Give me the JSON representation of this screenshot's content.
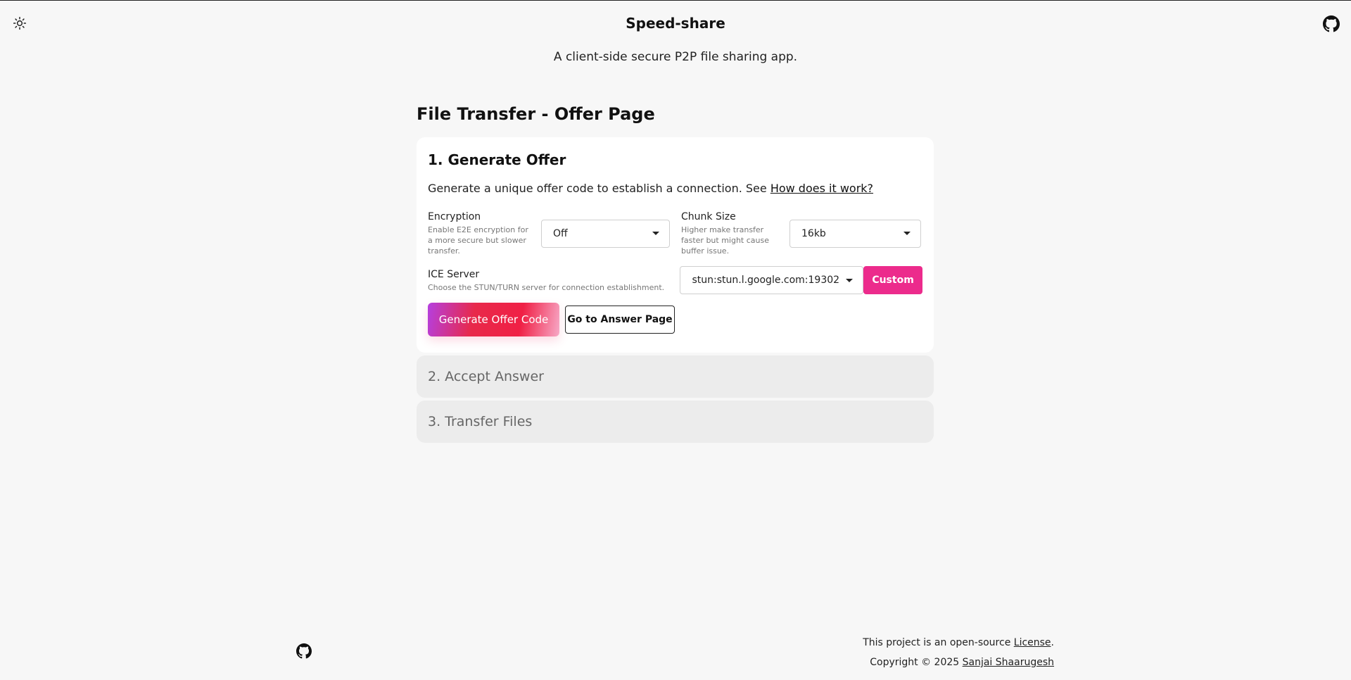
{
  "header": {
    "title": "Speed-share",
    "subtitle": "A client-side secure P2P file sharing app.",
    "theme_icon": "sun-icon",
    "github_icon": "github-icon"
  },
  "page": {
    "title": "File Transfer - Offer Page"
  },
  "step1": {
    "title": "1. Generate Offer",
    "desc_text": "Generate a unique offer code to establish a connection. See ",
    "desc_link": "How does it work?",
    "encryption": {
      "label": "Encryption",
      "hint": "Enable E2E encryption for a more secure but slower transfer.",
      "value": "Off"
    },
    "chunk_size": {
      "label": "Chunk Size",
      "hint": "Higher make transfer faster but might cause buffer issue.",
      "value": "16kb"
    },
    "ice_server": {
      "label": "ICE Server",
      "hint": "Choose the STUN/TURN server for connection establishment.",
      "value": "stun:stun.l.google.com:19302",
      "custom_label": "Custom"
    },
    "generate_label": "Generate Offer Code",
    "answer_page_label": "Go to Answer Page"
  },
  "step2": {
    "title": "2. Accept Answer"
  },
  "step3": {
    "title": "3. Transfer Files"
  },
  "footer": {
    "line1_text": "This project is an open-source ",
    "line1_link": "License",
    "line1_end": ".",
    "line2_text": "Copyright © 2025 ",
    "line2_link": "Sanjai Shaarugesh"
  },
  "colors": {
    "accent_pink": "#ec2b8c",
    "background": "#f7f7f7"
  }
}
